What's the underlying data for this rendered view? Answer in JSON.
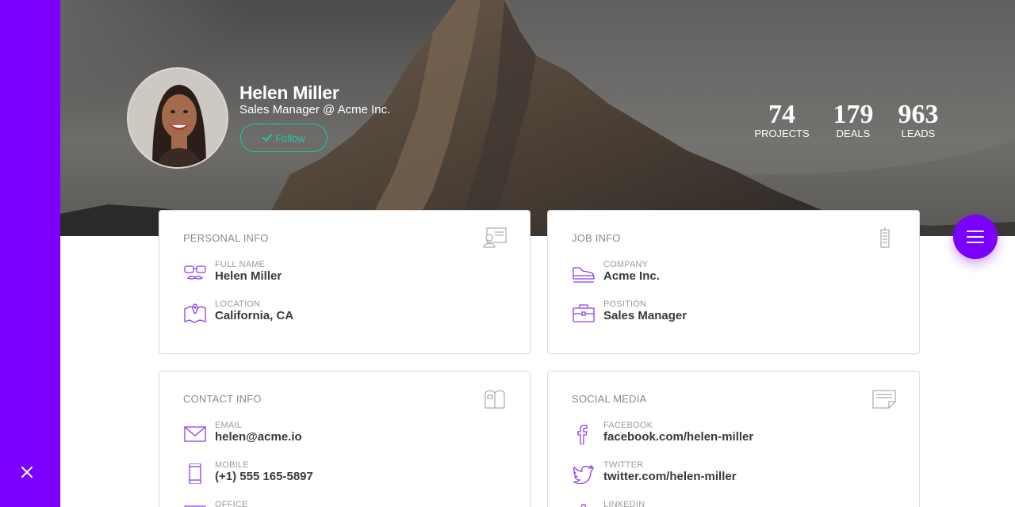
{
  "profile": {
    "name": "Helen Miller",
    "role": "Sales Manager @ Acme Inc.",
    "follow_label": "Follow"
  },
  "stats": [
    {
      "value": "74",
      "label": "PROJECTS"
    },
    {
      "value": "179",
      "label": "DEALS"
    },
    {
      "value": "963",
      "label": "LEADS"
    }
  ],
  "colors": {
    "accent": "#7a00ff",
    "follow": "#1ec8a5"
  },
  "cards": {
    "personal": {
      "title": "PERSONAL INFO",
      "icon": "id-card-icon",
      "fields": [
        {
          "label": "FULL NAME",
          "value": "Helen Miller",
          "icon": "glasses-mustache-icon"
        },
        {
          "label": "LOCATION",
          "value": "California, CA",
          "icon": "map-pin-icon"
        }
      ]
    },
    "job": {
      "title": "JOB INFO",
      "icon": "building-icon",
      "fields": [
        {
          "label": "COMPANY",
          "value": "Acme Inc.",
          "icon": "shoe-icon"
        },
        {
          "label": "POSITION",
          "value": "Sales Manager",
          "icon": "briefcase-icon"
        }
      ]
    },
    "contact": {
      "title": "CONTACT INFO",
      "icon": "mailbox-icon",
      "fields": [
        {
          "label": "EMAIL",
          "value": "helen@acme.io",
          "icon": "envelope-icon"
        },
        {
          "label": "MOBILE",
          "value": "(+1) 555 165-5897",
          "icon": "smartphone-icon"
        },
        {
          "label": "OFFICE",
          "value": "",
          "icon": "phone-icon"
        }
      ]
    },
    "social": {
      "title": "SOCIAL MEDIA",
      "icon": "note-icon",
      "fields": [
        {
          "label": "FACEBOOK",
          "value": "facebook.com/helen-miller",
          "icon": "facebook-icon"
        },
        {
          "label": "TWITTER",
          "value": "twitter.com/helen-miller",
          "icon": "twitter-icon"
        },
        {
          "label": "LINKEDIN",
          "value": "",
          "icon": "linkedin-icon"
        }
      ]
    }
  }
}
